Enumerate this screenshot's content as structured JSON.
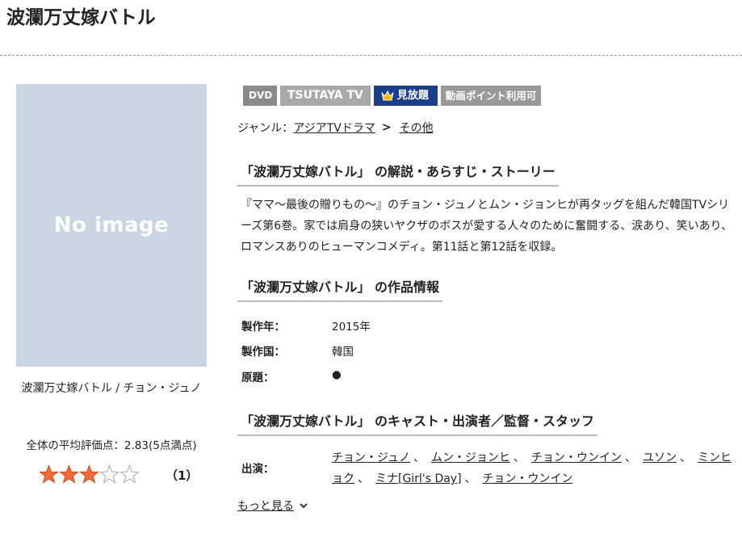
{
  "title": "波瀾万丈嫁バトル",
  "poster": {
    "placeholder": "No image"
  },
  "caption": "波瀾万丈嫁バトル / チョン・ジュノ",
  "rating": {
    "average_text": "全体の平均評価点：2.83(5点満点)",
    "average": 2.83,
    "max": 5,
    "filled_stars": 3,
    "count_text": "（1）"
  },
  "badges": {
    "dvd": "DVD",
    "tsutaya_tv": "TSUTAYA TV",
    "mihodai": "見放題",
    "point": "動画ポイント利用可"
  },
  "genre": {
    "label": "ジャンル：",
    "primary": "アジアTVドラマ",
    "separator": ">",
    "secondary": "その他"
  },
  "sections": {
    "synopsis_heading": "「波瀾万丈嫁バトル」 の解説・あらすじ・ストーリー",
    "info_heading": "「波瀾万丈嫁バトル」 の作品情報",
    "cast_heading": "「波瀾万丈嫁バトル」 のキャスト・出演者／監督・スタッフ"
  },
  "synopsis": "『ママ～最後の贈りもの～』のチョン・ジュノとムン・ジョンヒが再タッグを組んだ韓国TVシリーズ第6巻。家では肩身の狭いヤクザのボスが愛する人々のために奮闘する、涙あり、笑いあり、ロマンスありのヒューマンコメディ。第11話と第12話を収録。",
  "info": {
    "year_label": "製作年：",
    "year": "2015年",
    "country_label": "製作国：",
    "country": "韓国",
    "original_label": "原題：",
    "original": "●"
  },
  "cast": {
    "label": "出演：",
    "names": [
      "チョン・ジュノ",
      "ムン・ジョンヒ",
      "チョン・ウンイン",
      "ユソン",
      "ミンヒョク",
      "ミナ[Girl's Day]",
      "チョン・ウンイン"
    ],
    "separator": "、"
  },
  "more": "もっと見る",
  "colors": {
    "poster_bg": "#c9d5e0",
    "mihodai_bg": "#1a3f8a",
    "star_fill": "#f06a3a",
    "badge_gray": "#9a9a9a"
  }
}
